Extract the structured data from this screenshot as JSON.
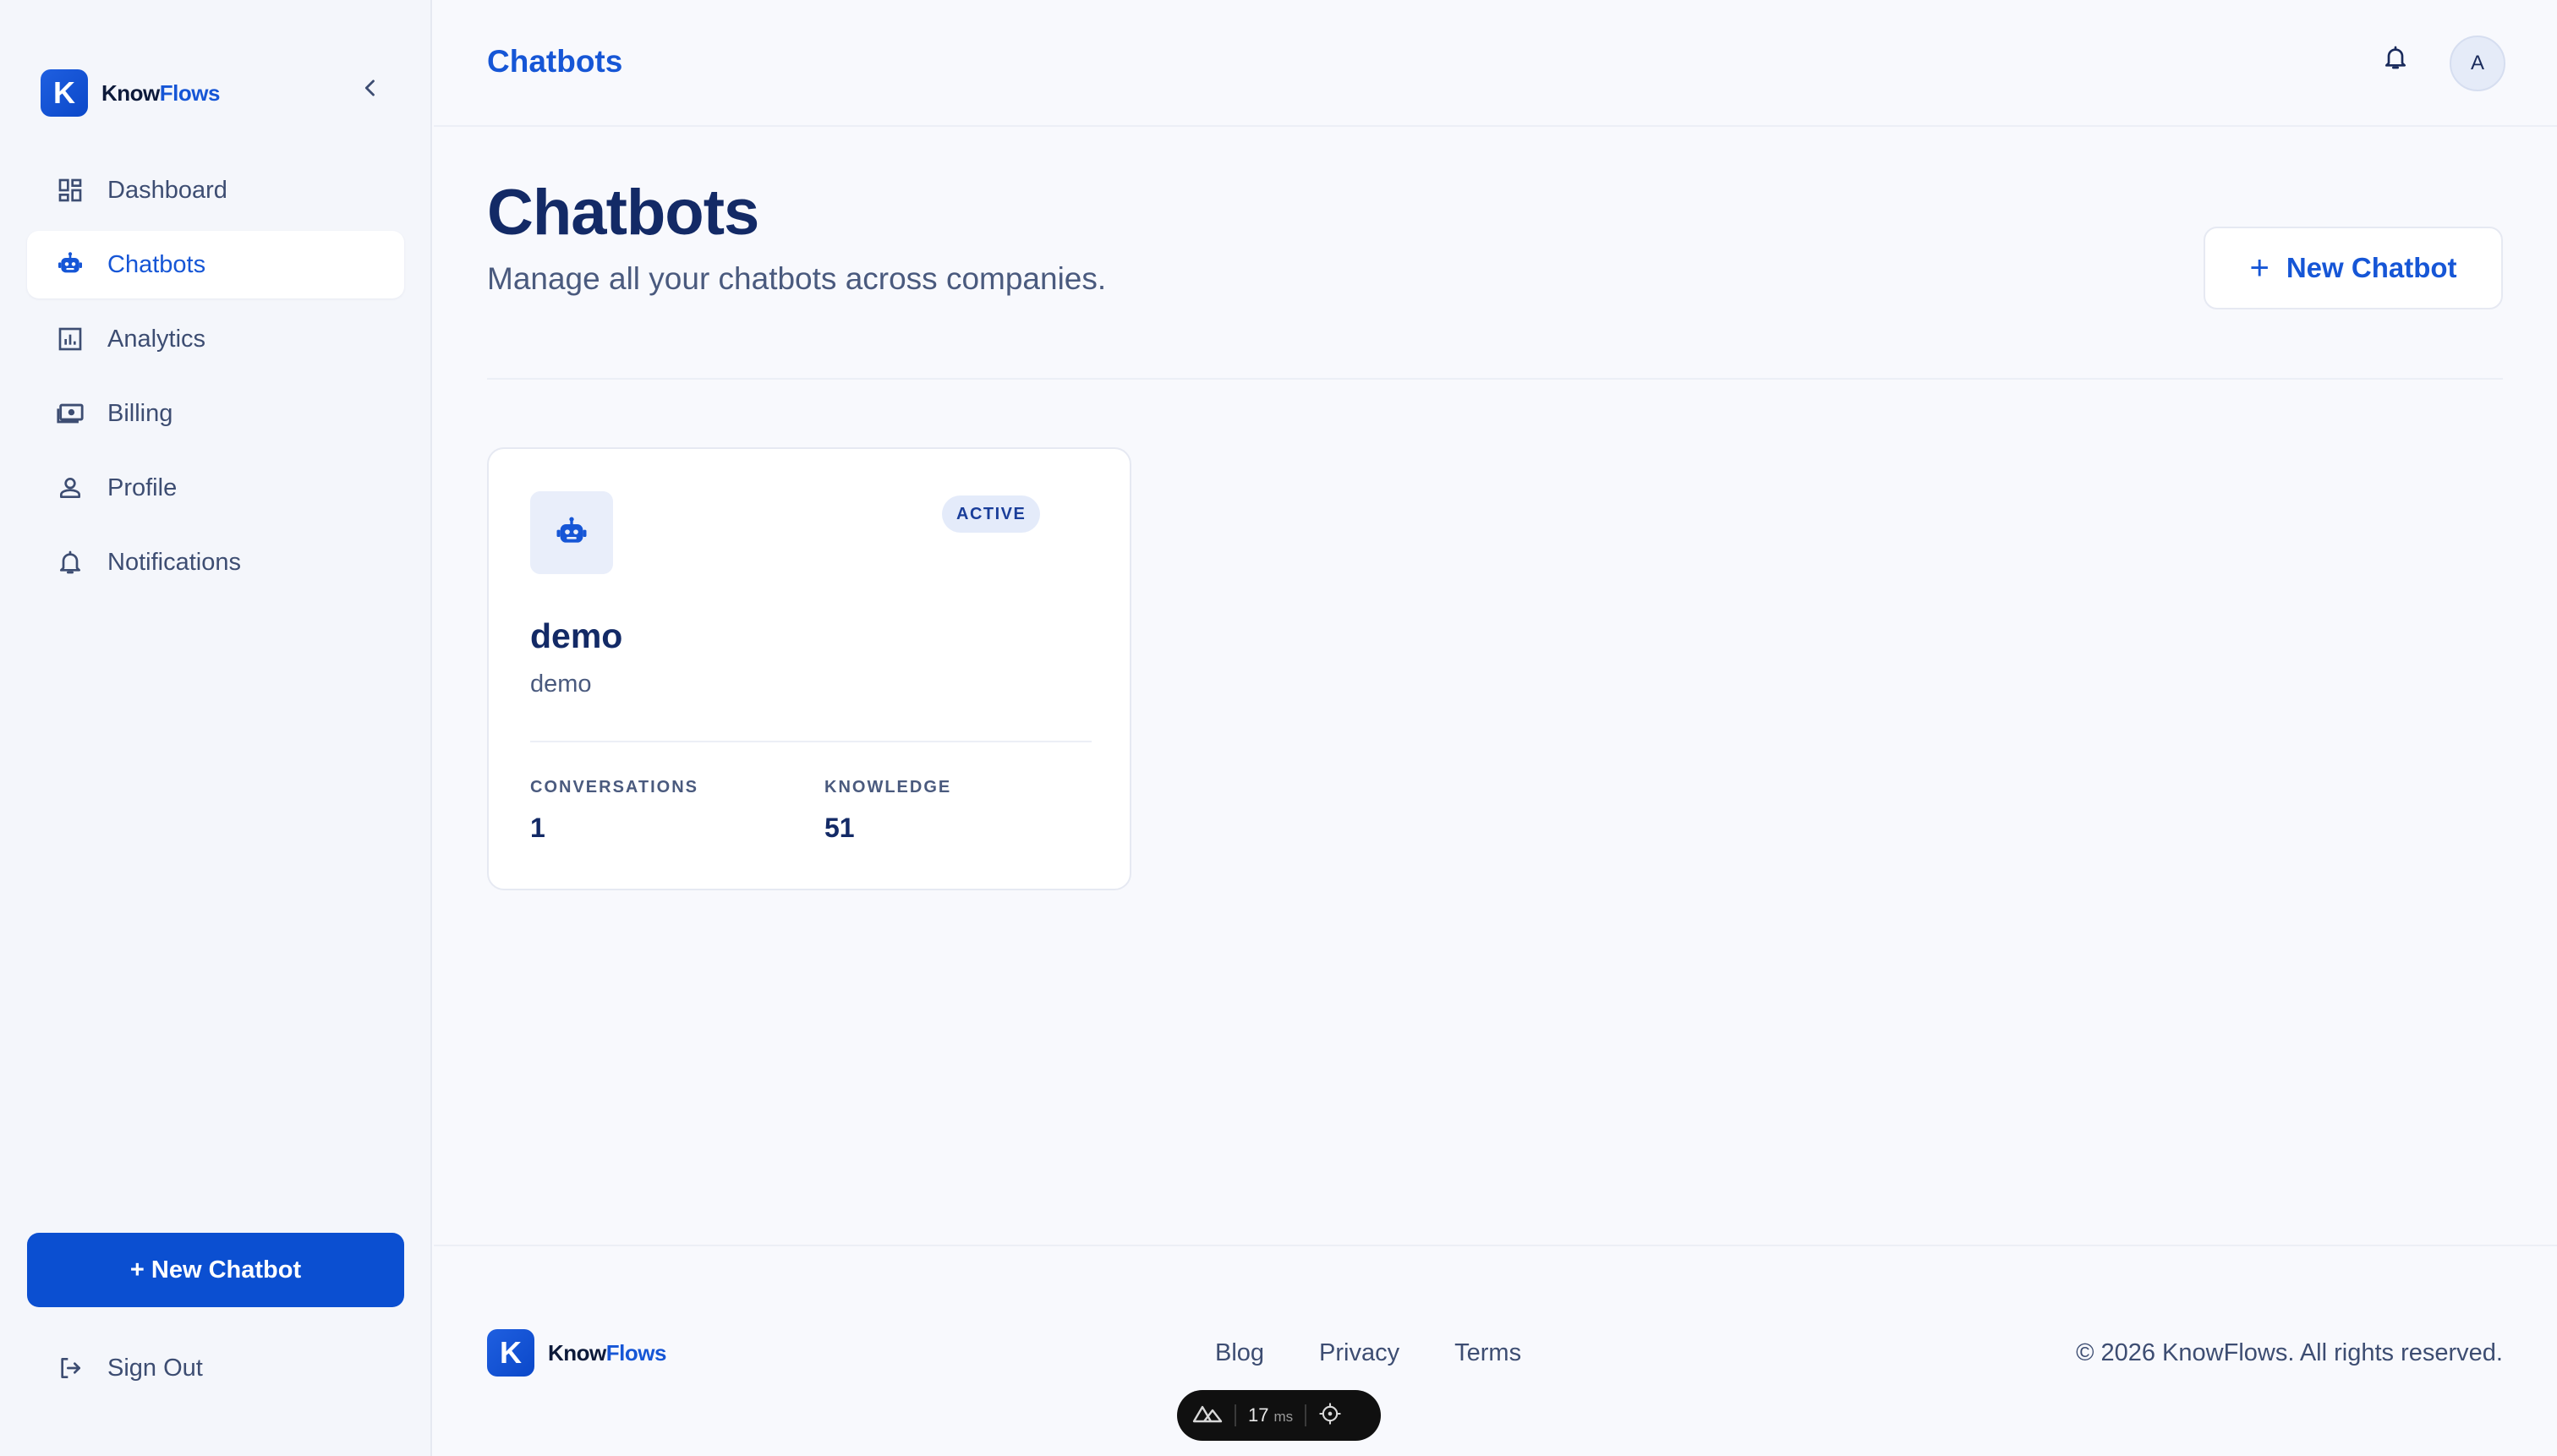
{
  "brand": {
    "name_part1": "Know",
    "name_part2": "Flows",
    "logo_letter": "K"
  },
  "sidebar": {
    "items": [
      {
        "label": "Dashboard",
        "icon": "dashboard-icon",
        "active": false
      },
      {
        "label": "Chatbots",
        "icon": "robot-icon",
        "active": true
      },
      {
        "label": "Analytics",
        "icon": "bar-chart-icon",
        "active": false
      },
      {
        "label": "Billing",
        "icon": "banknote-icon",
        "active": false
      },
      {
        "label": "Profile",
        "icon": "person-icon",
        "active": false
      },
      {
        "label": "Notifications",
        "icon": "bell-icon",
        "active": false
      }
    ],
    "new_button_label": "+ New Chatbot",
    "signout_label": "Sign Out"
  },
  "header": {
    "title": "Chatbots",
    "avatar_initial": "A"
  },
  "page": {
    "title": "Chatbots",
    "subtitle": "Manage all your chatbots across companies.",
    "new_button_label": "New Chatbot"
  },
  "chatbots": [
    {
      "name": "demo",
      "description": "demo",
      "status": "ACTIVE",
      "conversations_label": "CONVERSATIONS",
      "conversations": "1",
      "knowledge_label": "KNOWLEDGE",
      "knowledge": "51"
    }
  ],
  "footer": {
    "links": [
      "Blog",
      "Privacy",
      "Terms"
    ],
    "copyright": "© 2026 KnowFlows. All rights reserved."
  },
  "devtools": {
    "ms_value": "17",
    "ms_unit": "ms"
  },
  "colors": {
    "primary": "#1656d6",
    "primary_button": "#0b4fd1",
    "text_dark": "#132a66",
    "background": "#f8f9fd"
  }
}
